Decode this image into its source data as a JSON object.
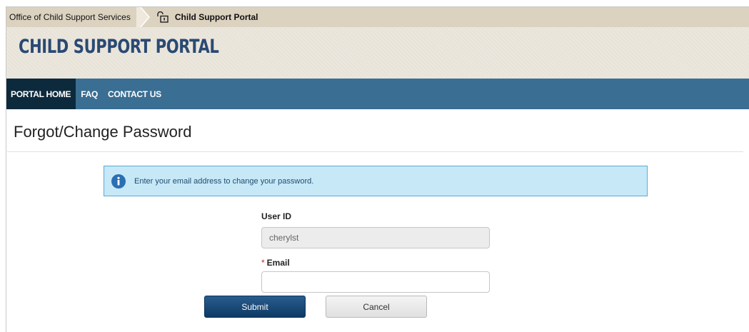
{
  "breadcrumb": {
    "parent": "Office of Child Support Services",
    "current": "Child Support Portal"
  },
  "banner": {
    "title": "CHILD SUPPORT PORTAL"
  },
  "nav": {
    "items": [
      {
        "label": "PORTAL HOME",
        "active": true
      },
      {
        "label": "FAQ"
      },
      {
        "label": "CONTACT US"
      }
    ]
  },
  "page": {
    "title": "Forgot/Change Password"
  },
  "info": {
    "message": "Enter your email address to change your password."
  },
  "form": {
    "user_id_label": "User ID",
    "user_id_value": "cherylst",
    "email_required_mark": "*",
    "email_label": "Email",
    "email_value": ""
  },
  "buttons": {
    "submit": "Submit",
    "cancel": "Cancel"
  },
  "colors": {
    "nav": "#3a6e92",
    "nav_active": "#0d2a3d",
    "brand_title": "#2a4a73",
    "info_bg": "#c7e8f7"
  }
}
